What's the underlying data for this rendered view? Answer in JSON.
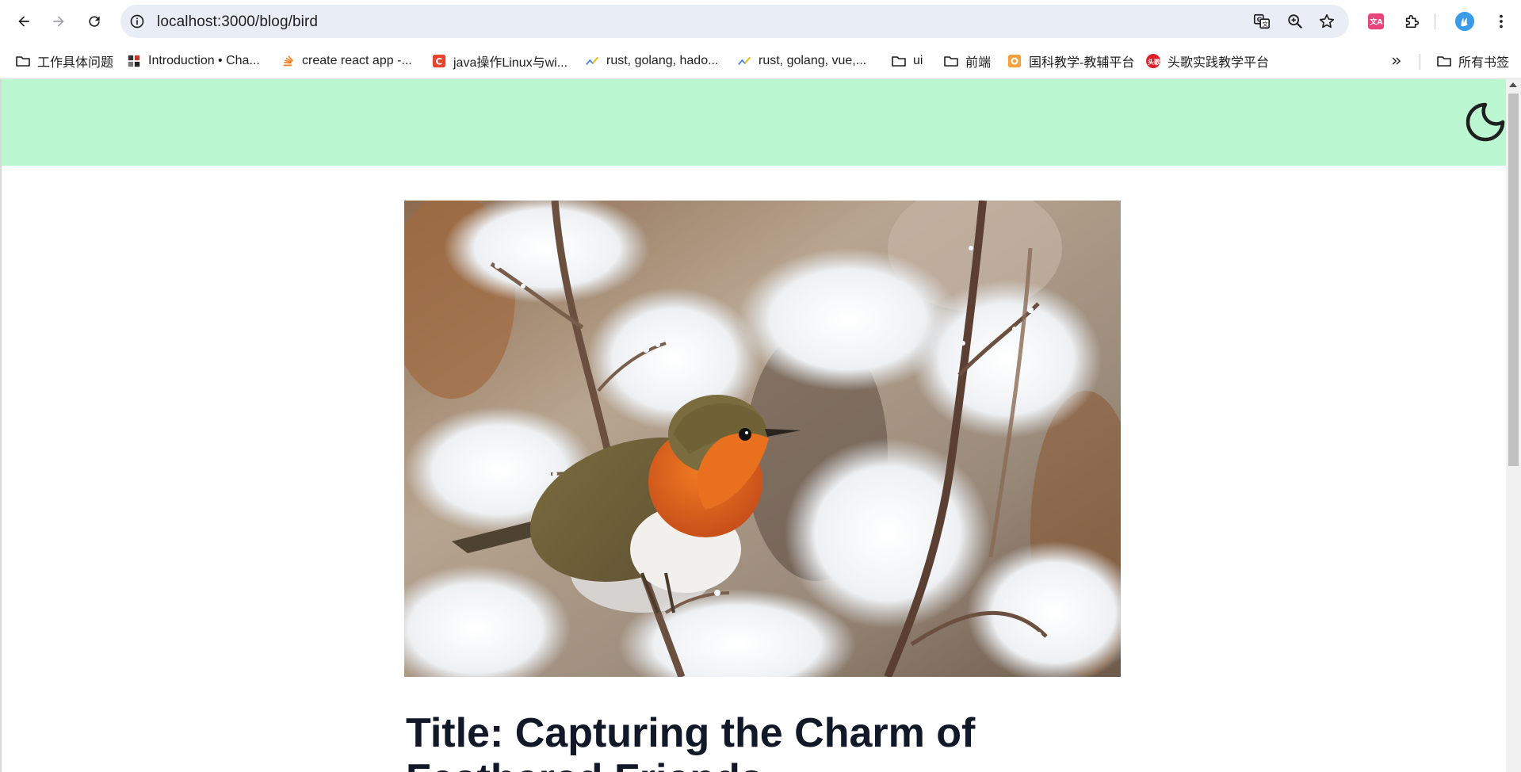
{
  "browser": {
    "url": "localhost:3000/blog/bird",
    "back_icon": "back-arrow-icon",
    "forward_icon": "forward-arrow-icon",
    "reload_icon": "reload-icon",
    "site_info_icon": "info-icon",
    "translate_icon": "translate-icon",
    "zoom_icon": "zoom-icon",
    "bookmark_icon": "star-icon",
    "extensions_icon": "puzzle-icon",
    "menu_icon": "kebab-menu-icon"
  },
  "bookmarks": {
    "items": [
      {
        "label": "工作具体问题",
        "icon": "folder-icon"
      },
      {
        "label": "Introduction • Cha...",
        "icon": "grid-favicon"
      },
      {
        "label": "create react app -...",
        "icon": "stack-favicon"
      },
      {
        "label": "java操作Linux与wi...",
        "icon": "c-favicon"
      },
      {
        "label": "rust, golang, hado...",
        "icon": "trend-favicon"
      },
      {
        "label": "rust, golang, vue,...",
        "icon": "trend-favicon"
      },
      {
        "label": "ui",
        "icon": "folder-icon"
      },
      {
        "label": "前端",
        "icon": "folder-icon"
      },
      {
        "label": "国科教学-教辅平台",
        "icon": "school-favicon"
      },
      {
        "label": "头歌实践教学平台",
        "icon": "toutiao-favicon"
      }
    ],
    "overflow_icon": "chevron-double-right-icon",
    "all_bookmarks_label": "所有书签"
  },
  "page": {
    "header_color": "#bbf7d0",
    "theme_toggle_icon": "moon-icon",
    "hero_image": "robin-in-snow-photo",
    "title": "Title: Capturing the Charm of Feathered Friends"
  },
  "colors": {
    "omnibox_bg": "#e9eef6",
    "title_text": "#111827"
  }
}
